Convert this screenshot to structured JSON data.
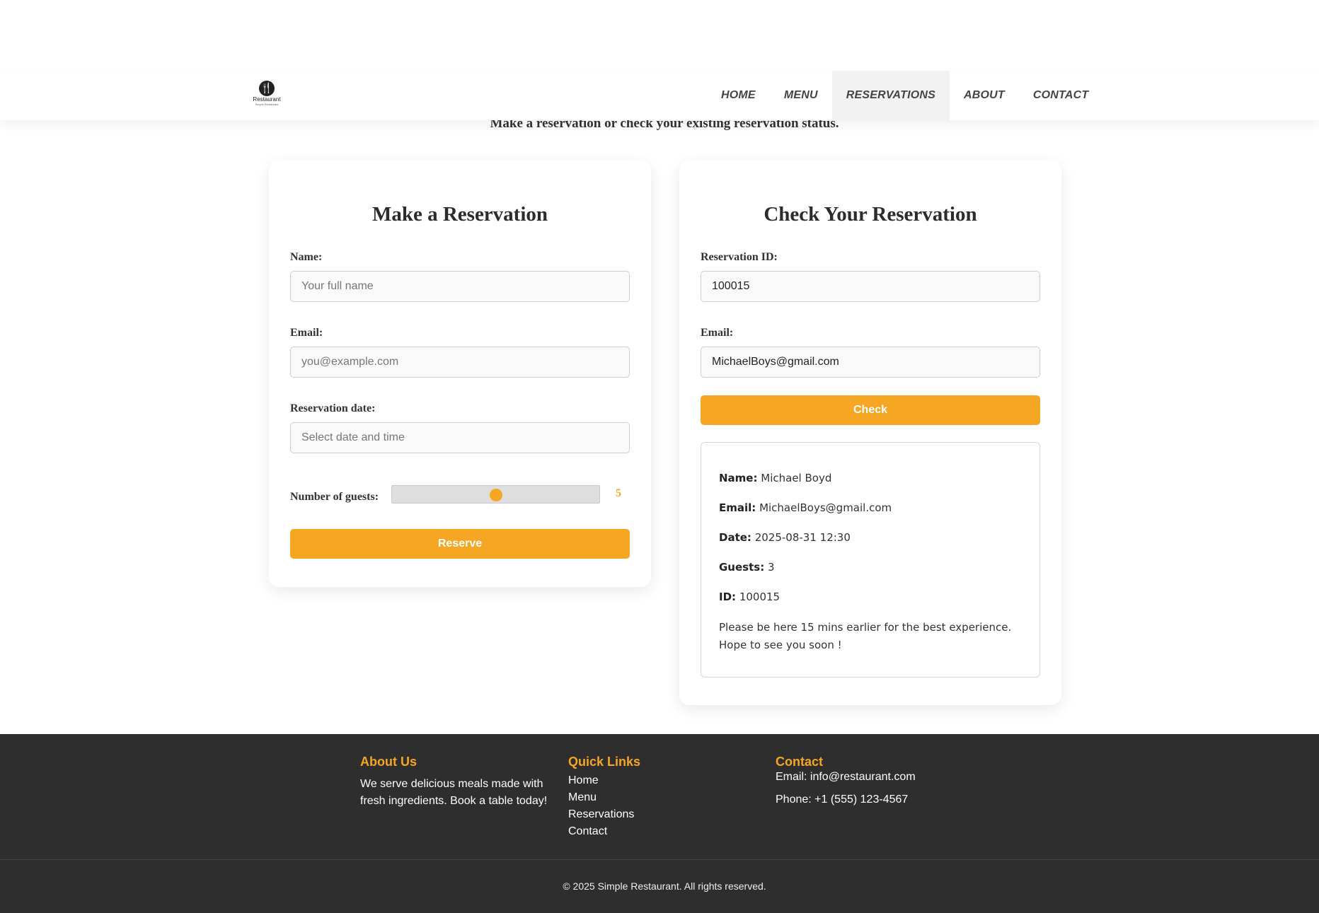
{
  "header": {
    "logo_text": "Restaurant",
    "logo_sub": "Simple Restaurant",
    "nav": [
      "HOME",
      "MENU",
      "RESERVATIONS",
      "ABOUT",
      "CONTACT"
    ],
    "active_nav": "RESERVATIONS"
  },
  "tagline": "Make a reservation or check your existing reservation status.",
  "make": {
    "title": "Make a Reservation",
    "name_label": "Name:",
    "name_placeholder": "Your full name",
    "email_label": "Email:",
    "email_placeholder": "you@example.com",
    "date_label": "Reservation date:",
    "date_placeholder": "Select date and time",
    "guests_label": "Number of guests:",
    "guests_value": "5",
    "guests_fill_fraction": 0.5,
    "reserve_label": "Reserve"
  },
  "check": {
    "title": "Check Your Reservation",
    "id_label": "Reservation ID:",
    "id_value": "100015",
    "email_label": "Email:",
    "email_value": "MichaelBoys@gmail.com",
    "check_label": "Check",
    "result": {
      "name_key": "Name:",
      "name_val": "Michael Boyd",
      "email_key": "Email:",
      "email_val": "MichaelBoys@gmail.com",
      "date_key": "Date:",
      "date_val": "2025-08-31 12:30",
      "guests_key": "Guests:",
      "guests_val": "3",
      "id_key": "ID:",
      "id_val": "100015",
      "note_line1": "Please be here 15 mins earlier for the best experience.",
      "note_line2": "Hope to see you soon !"
    }
  },
  "footer": {
    "about_title": "About Us",
    "about_text": "We serve delicious meals made with fresh ingredients. Book a table today!",
    "links_title": "Quick Links",
    "links": [
      "Home",
      "Menu",
      "Reservations",
      "Contact"
    ],
    "contact_title": "Contact",
    "contact_email": "Email: info@restaurant.com",
    "contact_phone": "Phone: +1 (555) 123-4567",
    "copyright": "© 2025 Simple Restaurant. All rights reserved."
  },
  "colors": {
    "accent": "#f5a623",
    "footer_bg": "#2e2e2e"
  }
}
